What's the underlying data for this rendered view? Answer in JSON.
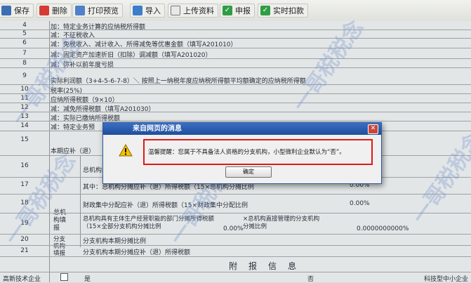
{
  "toolbar": {
    "save": "保存",
    "delete": "删除",
    "print_preview": "打印预览",
    "import": "导入",
    "upload": "上传资料",
    "declare": "申报",
    "realtime_deduct": "实时扣款"
  },
  "rows": [
    {
      "no": "4",
      "text": "加：特定业务计算的应纳税所得额"
    },
    {
      "no": "5",
      "text": "减：不征税收入"
    },
    {
      "no": "6",
      "text": "减：免税收入、减计收入、所得减免等优惠金额（填写A201010）"
    },
    {
      "no": "7",
      "text": "减：固定资产加速折旧（扣除）调减额（填写A201020）"
    },
    {
      "no": "8",
      "text": "减：弥补以前年度亏损"
    },
    {
      "no": "9",
      "text": "实际利润额（3+4-5-6-7-8）＼ 按照上一纳税年度应纳税所得额平均额确定的应纳税所得额"
    },
    {
      "no": "10",
      "text": "税率(25%)"
    },
    {
      "no": "11",
      "text": "应纳所得税额（9×10）"
    },
    {
      "no": "12",
      "text": "减：减免所得税额（填写A201030）"
    },
    {
      "no": "13",
      "text": "减：实际已缴纳所得税额"
    },
    {
      "no": "14",
      "text": "减：特定业务预"
    },
    {
      "no": "15",
      "text": "本期应补（退）"
    },
    {
      "no": "16",
      "text": "总机构本"
    },
    {
      "no": "17",
      "text": "其中：总机构分摊应补（退）所得税额（15×总机构分摊比例"
    },
    {
      "no": "18",
      "text": "财政集中分配应补（退）所得税额（15×财政集中分配比例"
    },
    {
      "no": "19",
      "text": "总机构具有主体生产经营职能的部门分摊所得税额（15×全部分支机构分摊比例"
    },
    {
      "no": "20",
      "text": "分支机构本期分摊比例"
    },
    {
      "no": "21",
      "text": "分支机构本期分摊应补（退）所得税额"
    }
  ],
  "side_labels": {
    "head_office": "总机构填报",
    "branch": "分支机构填报"
  },
  "values": {
    "r17_pct": "0.00%",
    "r18_pct": "0.00%",
    "r19_pct": "0.00%",
    "r19_pct2": "0.0000000000%",
    "r19_branch": "×总机构直接管理的分支机构分摊比例"
  },
  "attached_info": {
    "title": "附　报　信　息",
    "high_tech": "高新技术企业",
    "yes": "是",
    "no": "否",
    "tech_sme": "科技型中小企业"
  },
  "dialog": {
    "title": "来自网页的消息",
    "message": "温馨提醒：您属于不具备法人资格的分支机构，小型微利企业默认为“否”。",
    "ok": "确定"
  },
  "watermark": "一哥税税念"
}
